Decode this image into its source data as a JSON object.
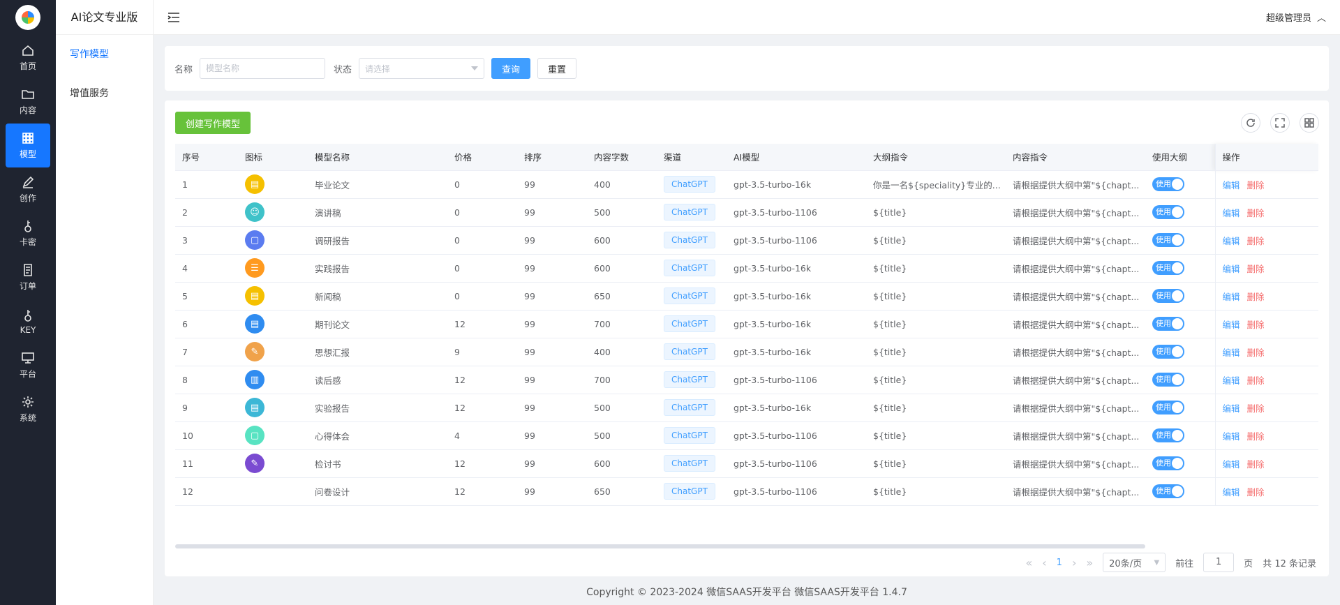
{
  "brand": "AI论文专业版",
  "rail": [
    {
      "label": "首页",
      "icon": "home-icon"
    },
    {
      "label": "内容",
      "icon": "folder-icon"
    },
    {
      "label": "模型",
      "icon": "grid-icon",
      "active": true
    },
    {
      "label": "创作",
      "icon": "pen-icon"
    },
    {
      "label": "卡密",
      "icon": "key-icon"
    },
    {
      "label": "订单",
      "icon": "doc-icon"
    },
    {
      "label": "KEY",
      "icon": "key-icon"
    },
    {
      "label": "平台",
      "icon": "monitor-icon"
    },
    {
      "label": "系统",
      "icon": "gear-icon"
    }
  ],
  "submenu": [
    "写作模型",
    "增值服务"
  ],
  "topbar": {
    "user": "超级管理员"
  },
  "filter": {
    "name_label": "名称",
    "name_placeholder": "模型名称",
    "status_label": "状态",
    "status_placeholder": "请选择",
    "query": "查询",
    "reset": "重置"
  },
  "create_button": "创建写作模型",
  "table": {
    "headers": [
      "序号",
      "图标",
      "模型名称",
      "价格",
      "排序",
      "内容字数",
      "渠道",
      "AI模型",
      "大纲指令",
      "内容指令",
      "使用大纲",
      "操作"
    ],
    "rows": [
      {
        "id": "1",
        "color": "#f5c000",
        "glyph": "▤",
        "name": "毕业论文",
        "price": "0",
        "sort": "99",
        "words": "400",
        "channel": "ChatGPT",
        "model": "gpt-3.5-turbo-16k",
        "outline": "你是一名${speciality}专业的...",
        "content": "请根据提供大纲中第\"${chapt..."
      },
      {
        "id": "2",
        "color": "#3fc2c9",
        "glyph": "☺",
        "name": "演讲稿",
        "price": "0",
        "sort": "99",
        "words": "500",
        "channel": "ChatGPT",
        "model": "gpt-3.5-turbo-1106",
        "outline": "${title}",
        "content": "请根据提供大纲中第\"${chapt..."
      },
      {
        "id": "3",
        "color": "#5b7cf0",
        "glyph": "▢",
        "name": "调研报告",
        "price": "0",
        "sort": "99",
        "words": "600",
        "channel": "ChatGPT",
        "model": "gpt-3.5-turbo-1106",
        "outline": "${title}",
        "content": "请根据提供大纲中第\"${chapt..."
      },
      {
        "id": "4",
        "color": "#ff9a1f",
        "glyph": "☰",
        "name": "实践报告",
        "price": "0",
        "sort": "99",
        "words": "600",
        "channel": "ChatGPT",
        "model": "gpt-3.5-turbo-16k",
        "outline": "${title}",
        "content": "请根据提供大纲中第\"${chapt..."
      },
      {
        "id": "5",
        "color": "#f5c000",
        "glyph": "▤",
        "name": "新闻稿",
        "price": "0",
        "sort": "99",
        "words": "650",
        "channel": "ChatGPT",
        "model": "gpt-3.5-turbo-16k",
        "outline": "${title}",
        "content": "请根据提供大纲中第\"${chapt..."
      },
      {
        "id": "6",
        "color": "#2f8cf0",
        "glyph": "▤",
        "name": "期刊论文",
        "price": "12",
        "sort": "99",
        "words": "700",
        "channel": "ChatGPT",
        "model": "gpt-3.5-turbo-16k",
        "outline": "${title}",
        "content": "请根据提供大纲中第\"${chapt..."
      },
      {
        "id": "7",
        "color": "#f0a24a",
        "glyph": "✎",
        "name": "思想汇报",
        "price": "9",
        "sort": "99",
        "words": "400",
        "channel": "ChatGPT",
        "model": "gpt-3.5-turbo-16k",
        "outline": "${title}",
        "content": "请根据提供大纲中第\"${chapt..."
      },
      {
        "id": "8",
        "color": "#2f8cf0",
        "glyph": "▥",
        "name": "读后感",
        "price": "12",
        "sort": "99",
        "words": "700",
        "channel": "ChatGPT",
        "model": "gpt-3.5-turbo-1106",
        "outline": "${title}",
        "content": "请根据提供大纲中第\"${chapt..."
      },
      {
        "id": "9",
        "color": "#3cb7d6",
        "glyph": "▤",
        "name": "实验报告",
        "price": "12",
        "sort": "99",
        "words": "500",
        "channel": "ChatGPT",
        "model": "gpt-3.5-turbo-16k",
        "outline": "${title}",
        "content": "请根据提供大纲中第\"${chapt..."
      },
      {
        "id": "10",
        "color": "#58e3c2",
        "glyph": "▢",
        "name": "心得体会",
        "price": "4",
        "sort": "99",
        "words": "500",
        "channel": "ChatGPT",
        "model": "gpt-3.5-turbo-1106",
        "outline": "${title}",
        "content": "请根据提供大纲中第\"${chapt..."
      },
      {
        "id": "11",
        "color": "#7a4bd1",
        "glyph": "✎",
        "name": "检讨书",
        "price": "12",
        "sort": "99",
        "words": "600",
        "channel": "ChatGPT",
        "model": "gpt-3.5-turbo-1106",
        "outline": "${title}",
        "content": "请根据提供大纲中第\"${chapt..."
      },
      {
        "id": "12",
        "color": "",
        "glyph": "",
        "name": "问卷设计",
        "price": "12",
        "sort": "99",
        "words": "650",
        "channel": "ChatGPT",
        "model": "gpt-3.5-turbo-1106",
        "outline": "${title}",
        "content": "请根据提供大纲中第\"${chapt..."
      }
    ],
    "switch_label": "使用",
    "edit": "编辑",
    "delete": "删除"
  },
  "pager": {
    "current": "1",
    "size": "20条/页",
    "goto_prefix": "前往",
    "goto_value": "1",
    "goto_suffix": "页",
    "total": "共 12 条记录"
  },
  "footer": "Copyright © 2023-2024 微信SAAS开发平台  微信SAAS开发平台 1.4.7"
}
